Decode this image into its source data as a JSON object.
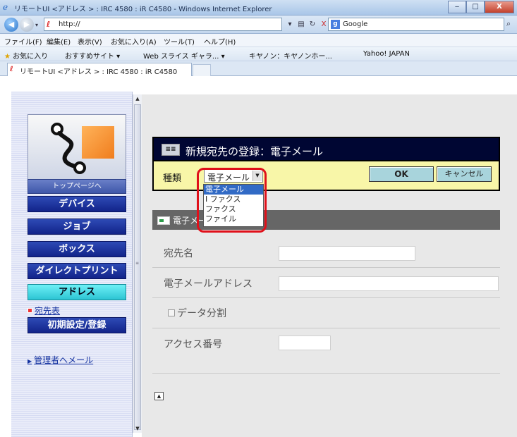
{
  "window": {
    "title": "リモートUI <アドレス > : IRC 4580 : iR C4580 - Windows Internet Explorer",
    "min_glyph": "‒",
    "max_glyph": "□",
    "close_glyph": "X"
  },
  "address_bar": {
    "url": "http://",
    "search_provider": "Google",
    "refresh_glyph": "↻",
    "stop_glyph": "X"
  },
  "menu": [
    "ファイル(F)",
    "編集(E)",
    "表示(V)",
    "お気に入り(A)",
    "ツール(T)",
    "ヘルプ(H)"
  ],
  "favorites": {
    "main": "お気に入り",
    "items": [
      "おすすめサイト ▾",
      "Web スライス ギャラ... ▾",
      "キヤノン：キヤノンホー...",
      "Yahoo! JAPAN"
    ]
  },
  "tab": {
    "label": "リモートUI <アドレス > : IRC 4580 : iR C4580"
  },
  "sidebar": {
    "top_page": "トップページへ",
    "nav": [
      "デバイス",
      "ジョブ",
      "ボックス",
      "ダイレクトプリント",
      "アドレス"
    ],
    "address_book": "宛先表",
    "settings": "初期設定/登録",
    "mail_admin": "管理者へメール"
  },
  "dialog": {
    "title": "新規宛先の登録：電子メール",
    "type_label": "種類",
    "selected_type": "電子メール",
    "ok_label": "OK",
    "cancel_label": "キャンセル",
    "type_options": [
      "電子メール",
      "I ファクス",
      "ファクス",
      "ファイル"
    ],
    "section_title": "電子メール",
    "fields": {
      "name_label": "宛先名",
      "name_value": "",
      "email_label": "電子メールアドレス",
      "email_value": "",
      "split_label": "データ分割",
      "access_label": "アクセス番号",
      "access_value": ""
    }
  },
  "colors": {
    "dialog_header": "#000633",
    "type_bar": "#f8f6a8",
    "nav_button": "#1a2f9c",
    "nav_active": "#4fdbe6",
    "highlight": "#e0101a"
  }
}
